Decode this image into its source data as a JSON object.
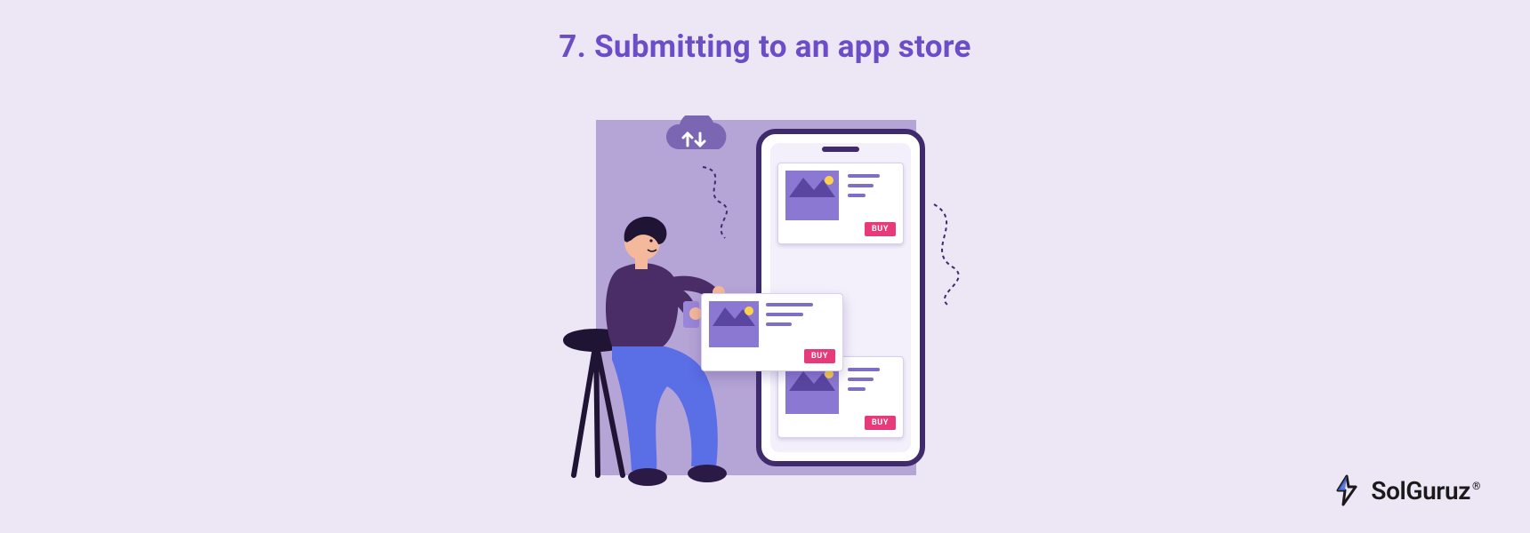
{
  "title": "7. Submitting to an app store",
  "illustration": {
    "buy_label": "BUY",
    "cloud_icon": "cloud-upload-icon"
  },
  "brand": {
    "name": "SolGuruz",
    "registered_mark": "®"
  },
  "colors": {
    "bg": "#ece6f5",
    "accent": "#6a4dc7",
    "phone_border": "#3f2a6b",
    "card_thumb": "#8b78d2",
    "buy": "#e63a7a",
    "person_shirt": "#4a2d66",
    "person_pants": "#5a6ee6",
    "person_skin": "#f4b89c"
  }
}
